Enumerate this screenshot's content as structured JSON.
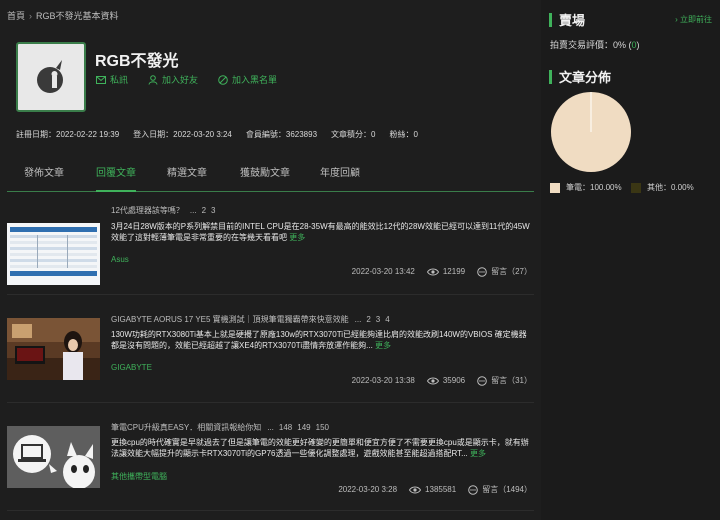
{
  "breadcrumb": {
    "home": "首頁",
    "current": "RGB不發光基本資料"
  },
  "profile": {
    "username": "RGB不發光",
    "actions": {
      "message": "私訊",
      "add_friend": "加入好友",
      "blacklist": "加入黑名單"
    },
    "stats": {
      "register": "註冊日期：2022-02-22 19:39",
      "login": "登入日期：2022-03-20 3:24",
      "member_id": "會員編號：3623893",
      "points": "文章積分：0",
      "fans": "粉絲：0"
    }
  },
  "tabs": [
    "發佈文章",
    "回覆文章",
    "精選文章",
    "獲鼓勵文章",
    "年度回顧"
  ],
  "active_tab": "回覆文章",
  "posts": [
    {
      "title": "12代處理器該等嗎？",
      "pages": [
        "...",
        "2",
        "3"
      ],
      "body": "3月24日28W版本的P系列解禁目前的INTEL CPU是在28-35W有最高的能效比12代的28W效能已經可以達到11代的45W效能了這對輕薄筆電是非常重要的在等幾天看看吧",
      "more": "更多",
      "category": "Asus",
      "date": "2022-03-20 13:42",
      "views": "12199",
      "replies": "留言（27）"
    },
    {
      "title": "GIGABYTE AORUS 17 YE5 實機測試｜頂規筆電獨霸帶來快意效能",
      "pages": [
        "...",
        "2",
        "3",
        "4"
      ],
      "body": "130W功耗的RTX3080Ti基本上就是硬攪了原廠130w的RTX3070Ti已經能夠達比肩的效能改刷140W的VBIOS 確定機器都是沒有問題的，效能已經超越了讓XE4的RTX3070Ti盡情奔放運作能夠...",
      "more": "更多",
      "category": "GIGABYTE",
      "date": "2022-03-20 13:38",
      "views": "35906",
      "replies": "留言（31）"
    },
    {
      "title": "筆電CPU升級真EASY．相關資訊報給你知",
      "pages": [
        "...",
        "148",
        "149",
        "150"
      ],
      "body": "更換cpu的時代確實是早就過去了但是讓筆電的效能更好確變的更簡單和便宜方便了不需要更換cpu或是顯示卡，就有辦法讓效能大幅提升的顯示卡RTX3070Ti的GP76透過一些優化調整處理，遊戲效能甚至能超過搭配RT...",
      "more": "更多",
      "category": "其他攜帶型電腦",
      "date": "2022-03-20 3:28",
      "views": "1385581",
      "replies": "留言（1494）"
    }
  ],
  "sidebar": {
    "market_title": "賣場",
    "go_link": "立即前往",
    "rating_label": "拍賣交易評價：",
    "rating_value": "0%",
    "rating_count": "0",
    "chart_title": "文章分佈",
    "colors": {
      "accent": "#3fb25b",
      "notebook": "#f0dcc2",
      "other": "#3a3614"
    }
  },
  "chart_data": {
    "type": "pie",
    "slices": [
      {
        "label": "筆電：100.00%",
        "value": 100.0,
        "color": "#f0dcc2"
      },
      {
        "label": "其他：0.00%",
        "value": 0.0,
        "color": "#3a3614"
      }
    ]
  }
}
